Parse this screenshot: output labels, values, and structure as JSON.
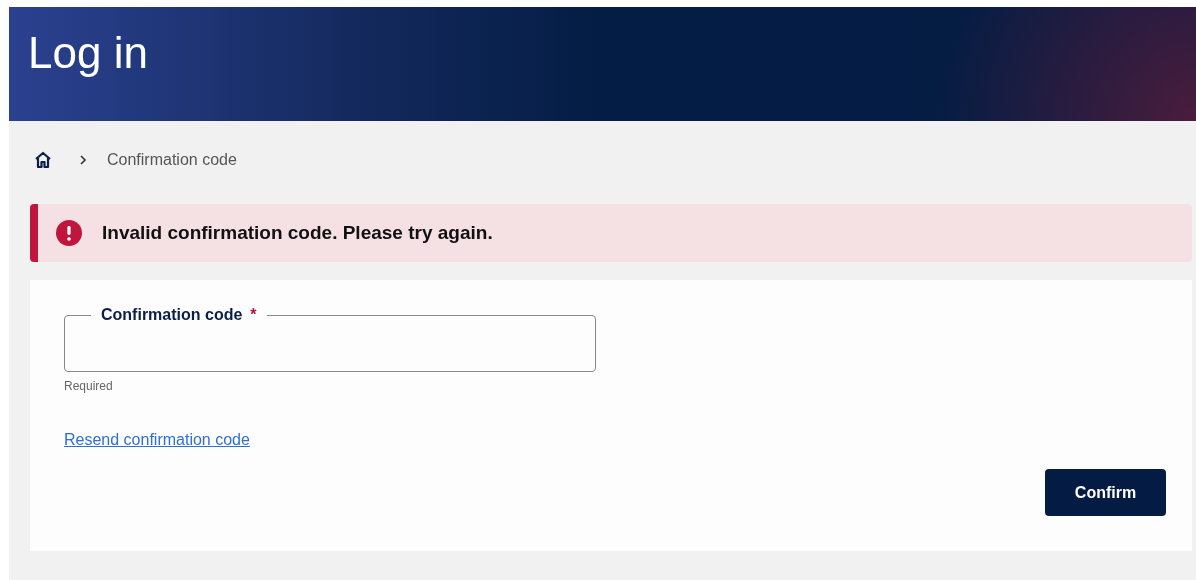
{
  "header": {
    "title": "Log in"
  },
  "breadcrumb": {
    "items": [
      "Confirmation code"
    ]
  },
  "alert": {
    "kind": "error",
    "message": "Invalid confirmation code. Please try again."
  },
  "form": {
    "field": {
      "label": "Confirmation code",
      "required_mark": "*",
      "hint": "Required"
    },
    "link": "Resend confirmation code",
    "submit": "Confirm"
  }
}
